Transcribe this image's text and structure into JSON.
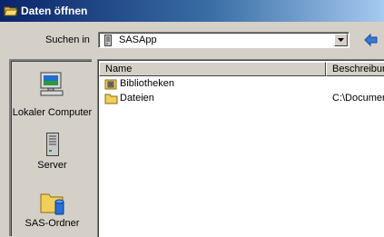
{
  "window": {
    "title": "Daten öffnen"
  },
  "lookin": {
    "label": "Suchen in",
    "value": "SASApp"
  },
  "places": [
    {
      "label": "Lokaler Computer"
    },
    {
      "label": "Server"
    },
    {
      "label": "SAS-Ordner"
    }
  ],
  "filelist": {
    "columns": [
      "Name",
      "Beschreibung"
    ],
    "rows": [
      {
        "name": "Bibliotheken",
        "description": ""
      },
      {
        "name": "Dateien",
        "description": "C:\\Documents"
      }
    ]
  },
  "colors": {
    "title_start": "#0a246a",
    "title_end": "#a6caf0",
    "face": "#d4d0c8",
    "folder": "#f2cf5a"
  }
}
